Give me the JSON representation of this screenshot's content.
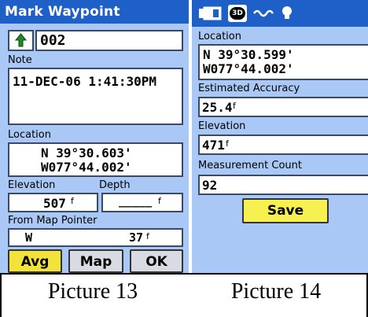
{
  "left_screen": {
    "title": "Mark Waypoint",
    "waypoint_name": "002",
    "note_label": "Note",
    "note_value": "11-DEC-06 1:41:30PM",
    "location_label": "Location",
    "lat": "N  39°30.603'",
    "lon": "W077°44.002'",
    "elevation_label": "Elevation",
    "elevation_value": "507",
    "elevation_unit": "f",
    "depth_label": "Depth",
    "depth_value": "_____",
    "depth_unit": "f",
    "from_label": "From Map Pointer",
    "direction": "W",
    "distance": "37",
    "distance_unit": "f",
    "buttons": {
      "avg": "Avg",
      "map": "Map",
      "ok": "OK"
    }
  },
  "right_screen": {
    "location_label": "Location",
    "lat": "N  39°30.599'",
    "lon": "W077°44.002'",
    "accuracy_label": "Estimated Accuracy",
    "accuracy_value": "25.4",
    "accuracy_unit": "f",
    "elevation_label": "Elevation",
    "elevation_value": "471",
    "elevation_unit": "f",
    "count_label": "Measurement Count",
    "count_value": "92",
    "save_label": "Save",
    "status_3d": "3D"
  },
  "captions": {
    "left": "Picture 13",
    "right": "Picture 14"
  },
  "colors": {
    "title_bar": "#1f5fc8",
    "panel": "#a9c8f5",
    "button": "#f6f050"
  },
  "icons": [
    "flag-icon",
    "battery-icon",
    "gps-3d-icon",
    "wave-icon",
    "lightbulb-icon"
  ]
}
